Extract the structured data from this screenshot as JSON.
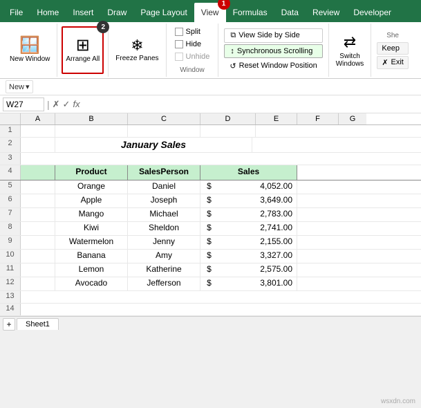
{
  "tabs": {
    "items": [
      "File",
      "Home",
      "Insert",
      "Draw",
      "Page Layout",
      "View",
      "Formulas",
      "Data",
      "Review",
      "Developer"
    ],
    "active": "View"
  },
  "ribbon": {
    "groups": {
      "window": {
        "label": "Window",
        "new_window": "New Window",
        "arrange_all": "Arrange All",
        "freeze_panes": "Freeze Panes",
        "split": "Split",
        "hide": "Hide",
        "unhide": "Unhide",
        "view_side_by_side": "View Side by Side",
        "sync_scrolling": "Synchronous Scrolling",
        "reset_position": "Reset Window Position",
        "switch_windows": "Switch Windows"
      },
      "sheetshed": {
        "label": "She",
        "keep": "Keep",
        "exit": "Exit"
      }
    }
  },
  "formula_bar": {
    "cell_ref": "W27",
    "placeholder": ""
  },
  "quick_access": {
    "new": "New",
    "dropdown_arrow": "▾"
  },
  "spreadsheet": {
    "title": "January Sales",
    "col_headers": [
      "A",
      "B",
      "C",
      "D",
      "E",
      "F",
      "G"
    ],
    "row_numbers": [
      "1",
      "2",
      "3",
      "4",
      "5",
      "6",
      "7",
      "8",
      "9",
      "10",
      "11",
      "12",
      "13",
      "14"
    ],
    "headers": [
      "Product",
      "SalesPerson",
      "Sales"
    ],
    "data": [
      [
        "Orange",
        "Daniel",
        "$",
        "4,052.00"
      ],
      [
        "Apple",
        "Joseph",
        "$",
        "3,649.00"
      ],
      [
        "Mango",
        "Michael",
        "$",
        "2,783.00"
      ],
      [
        "Kiwi",
        "Sheldon",
        "$",
        "2,741.00"
      ],
      [
        "Watermelon",
        "Jenny",
        "$",
        "2,155.00"
      ],
      [
        "Banana",
        "Amy",
        "$",
        "3,327.00"
      ],
      [
        "Lemon",
        "Katherine",
        "$",
        "2,575.00"
      ],
      [
        "Avocado",
        "Jefferson",
        "$",
        "3,801.00"
      ]
    ]
  },
  "badges": {
    "badge1": "1",
    "badge2": "2"
  },
  "sheet_tab": "Sheet1",
  "watermark": "wsxdn.com"
}
